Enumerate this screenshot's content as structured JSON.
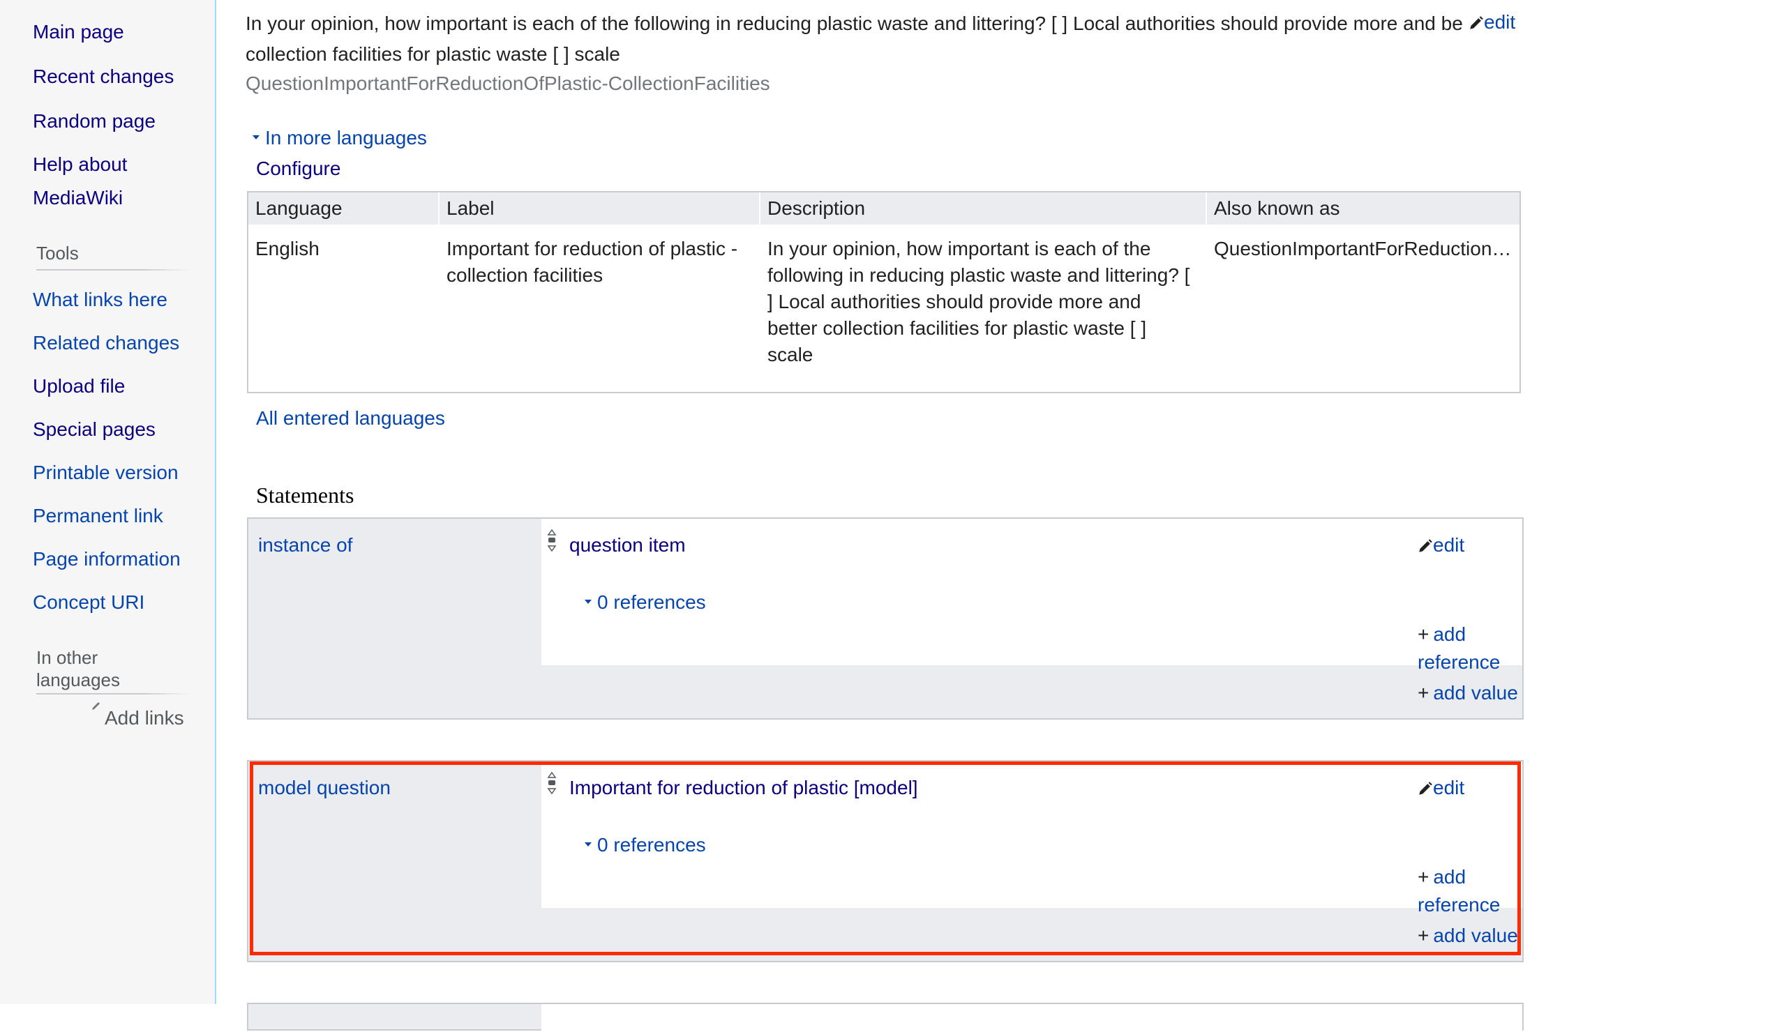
{
  "sidebar": {
    "navigation": [
      {
        "label": "Main page"
      },
      {
        "label": "Recent changes"
      },
      {
        "label": "Random page"
      },
      {
        "label": "Help about"
      },
      {
        "label": "MediaWiki"
      }
    ],
    "tools_heading": "Tools",
    "tools": [
      {
        "label": "What links here"
      },
      {
        "label": "Related changes"
      },
      {
        "label": "Upload file"
      },
      {
        "label": "Special pages"
      },
      {
        "label": "Printable version"
      },
      {
        "label": "Permanent link"
      },
      {
        "label": "Page information"
      },
      {
        "label": "Concept URI"
      }
    ],
    "languages_heading_1": "In other",
    "languages_heading_2": "languages",
    "add_links": "Add links"
  },
  "header": {
    "description_line1": "In your opinion, how important is each of the following in reducing plastic waste and littering? [ ] Local authorities should provide more and be",
    "description_line2": "collection facilities for plastic waste [ ] scale",
    "edit_label": "edit",
    "alias": "QuestionImportantForReductionOfPlastic-CollectionFacilities"
  },
  "languages": {
    "toggle_label": "In more languages",
    "configure_label": "Configure",
    "columns": [
      "Language",
      "Label",
      "Description",
      "Also known as"
    ],
    "row": {
      "language": "English",
      "label_line1": "Important for reduction of plastic -",
      "label_line2": "collection facilities",
      "description_lines": [
        "In your opinion, how important is each of the",
        "following in reducing plastic waste and littering? [",
        "] Local authorities should provide more and",
        "better collection facilities for plastic waste [ ]",
        "scale"
      ],
      "aka": "QuestionImportantForReduction…"
    },
    "all_entered_label": "All entered languages"
  },
  "statements": {
    "heading": "Statements",
    "groups": [
      {
        "property": "instance of",
        "value": "question item",
        "edit_label": "edit",
        "references_label": "0 references",
        "add_reference_label": "add reference",
        "add_value_label": "add value"
      },
      {
        "property": "model question",
        "value": "Important for reduction of plastic [model]",
        "edit_label": "edit",
        "references_label": "0 references",
        "add_reference_label": "add reference",
        "add_value_label": "add value"
      }
    ]
  },
  "colors": {
    "link": "#0645ad",
    "visited_link": "#0b0080",
    "highlight": "#ff2a00",
    "sidebar_bg": "#f6f6f6",
    "statement_bg": "#eaecf0"
  }
}
